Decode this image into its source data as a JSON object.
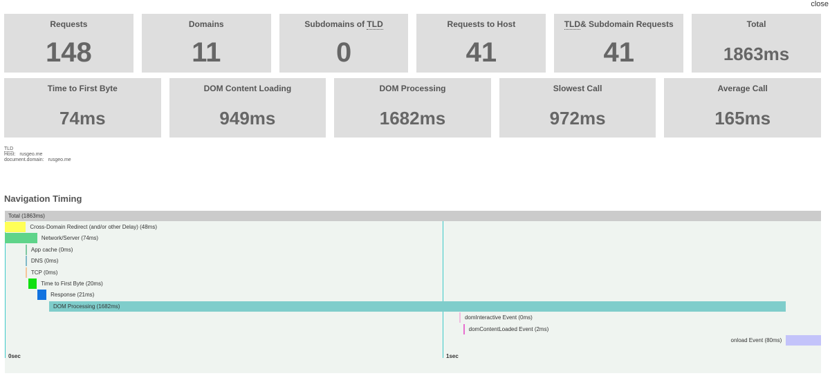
{
  "close_label": "close",
  "cards_row1": [
    {
      "label": "Requests",
      "value": "148",
      "size": "big"
    },
    {
      "label": "Domains",
      "value": "11",
      "size": "big"
    },
    {
      "label_pre": "Subdomains of ",
      "label_abbr": "TLD",
      "label_post": "",
      "value": "0",
      "size": "big"
    },
    {
      "label": "Requests to Host",
      "value": "41",
      "size": "big"
    },
    {
      "label_pre": "",
      "label_abbr": "TLD",
      "label_post": "& Subdomain Requests",
      "value": "41",
      "size": "big"
    },
    {
      "label": "Total",
      "value": "1863ms",
      "size": "mid"
    }
  ],
  "cards_row2": [
    {
      "label": "Time to First Byte",
      "value": "74ms"
    },
    {
      "label": "DOM Content Loading",
      "value": "949ms"
    },
    {
      "label": "DOM Processing",
      "value": "1682ms"
    },
    {
      "label": "Slowest Call",
      "value": "972ms"
    },
    {
      "label": "Average Call",
      "value": "165ms"
    }
  ],
  "info": {
    "tld_label": "TLD",
    "host_label": "Host:",
    "host_value": "rusgeo.me",
    "docdomain_label": "document.domain:",
    "docdomain_value": "rusgeo.me"
  },
  "navigation_title": "Navigation Timing",
  "chart_data": {
    "type": "bar",
    "title": "Navigation Timing",
    "total_label": "Total (1863ms)",
    "total_ms": 1863,
    "ticks": [
      {
        "ms": 0,
        "label": "0sec"
      },
      {
        "ms": 1000,
        "label": "1sec"
      }
    ],
    "series": [
      {
        "name": "Cross-Domain Redirect (and/or other Delay) (48ms)",
        "start": 0,
        "duration": 48,
        "color": "#ffff57"
      },
      {
        "name": "Network/Server (74ms)",
        "start": 0,
        "duration": 74,
        "color": "#5fd48a"
      },
      {
        "name": "App cache (0ms)",
        "start": 48,
        "duration": 0,
        "color": "#7ec8a0"
      },
      {
        "name": "DNS (0ms)",
        "start": 48,
        "duration": 0,
        "color": "#7fb9c8"
      },
      {
        "name": "TCP (0ms)",
        "start": 48,
        "duration": 0,
        "color": "#f5c59a"
      },
      {
        "name": "Time to First Byte (20ms)",
        "start": 53,
        "duration": 20,
        "color": "#11e011"
      },
      {
        "name": "Response (21ms)",
        "start": 74,
        "duration": 21,
        "color": "#1273e0"
      },
      {
        "name": "DOM Processing (1682ms)",
        "start": 101,
        "duration": 1682,
        "color": "#7fcdcb",
        "label_inside": true
      },
      {
        "name": "domInteractive Event (0ms)",
        "start": 1038,
        "duration": 0,
        "color": "#f0bde0"
      },
      {
        "name": "domContentLoaded Event (2ms)",
        "start": 1047,
        "duration": 2,
        "color": "#e86ed0"
      },
      {
        "name": "onload Event (80ms)",
        "start": 1783,
        "duration": 80,
        "color": "#c3c3fa",
        "label_left": true
      }
    ]
  }
}
